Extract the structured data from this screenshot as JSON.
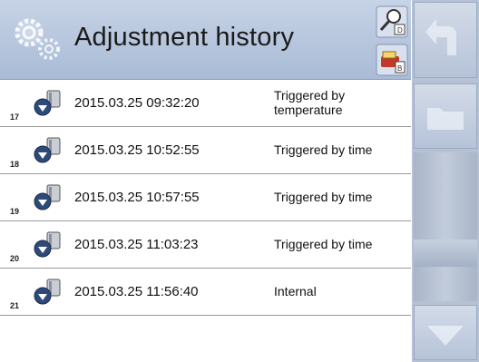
{
  "header": {
    "title": "Adjustment history",
    "icon": "gear-icon",
    "buttons": [
      {
        "name": "search-filter-button",
        "icon": "magnifier-icon"
      },
      {
        "name": "export-button",
        "icon": "export-icon"
      }
    ]
  },
  "rows": [
    {
      "num": "17",
      "date": "2015.03.25 09:32:20",
      "reason": "Triggered by temperature"
    },
    {
      "num": "18",
      "date": "2015.03.25 10:52:55",
      "reason": "Triggered by time"
    },
    {
      "num": "19",
      "date": "2015.03.25 10:57:55",
      "reason": "Triggered by time"
    },
    {
      "num": "20",
      "date": "2015.03.25 11:03:23",
      "reason": "Triggered by time"
    },
    {
      "num": "21",
      "date": "2015.03.25 11:56:40",
      "reason": "Internal"
    }
  ],
  "sidebar": {
    "buttons": [
      {
        "name": "back-button",
        "icon": "back-arrow-icon"
      },
      {
        "name": "folder-button",
        "icon": "folder-icon"
      },
      {
        "name": "scroll-down-button",
        "icon": "arrow-down-icon"
      }
    ]
  },
  "colors": {
    "header_bg": "#b8c6de",
    "sidebar_bg": "#b5c1d4",
    "divider": "#9a9a9a"
  }
}
